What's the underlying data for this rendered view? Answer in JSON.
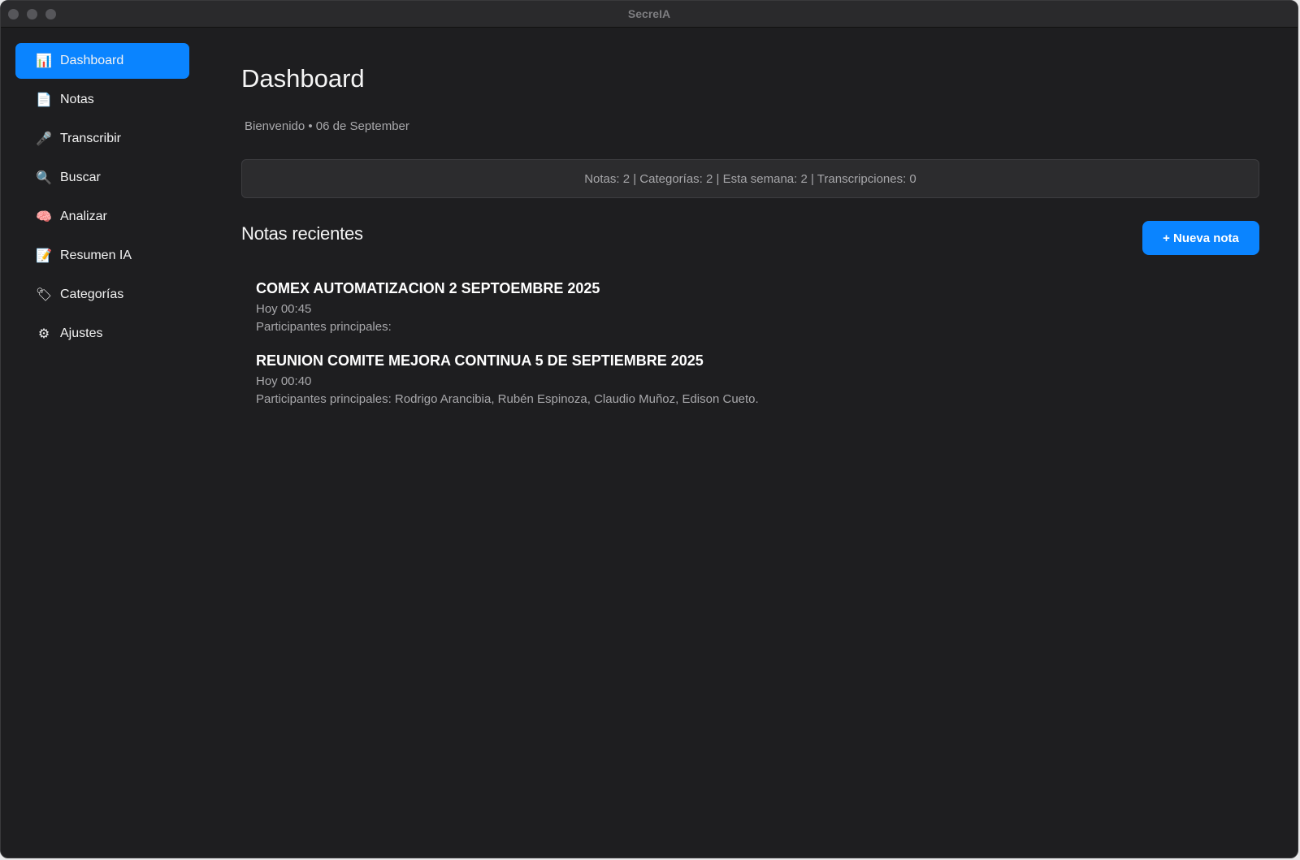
{
  "window": {
    "title": "SecreIA"
  },
  "sidebar": {
    "items": [
      {
        "icon": "📊",
        "icon_name": "bar-chart-icon",
        "label": "Dashboard",
        "active": true
      },
      {
        "icon": "📄",
        "icon_name": "document-icon",
        "label": "Notas"
      },
      {
        "icon": "🎤",
        "icon_name": "microphone-icon",
        "label": "Transcribir"
      },
      {
        "icon": "🔍",
        "icon_name": "magnifier-icon",
        "label": "Buscar"
      },
      {
        "icon": "🧠",
        "icon_name": "brain-icon",
        "label": "Analizar"
      },
      {
        "icon": "📝",
        "icon_name": "memo-icon",
        "label": "Resumen IA"
      },
      {
        "icon": "🏷",
        "icon_name": "tag-icon",
        "label": "Categorías"
      },
      {
        "icon": "⚙",
        "icon_name": "gear-icon",
        "label": "Ajustes"
      }
    ]
  },
  "main": {
    "title": "Dashboard",
    "subtitle": "Bienvenido • 06 de September",
    "stats": "Notas: 2 | Categorías: 2 | Esta semana: 2 | Transcripciones: 0",
    "recent_title": "Notas recientes",
    "new_note_label": "+ Nueva nota",
    "notes": [
      {
        "title": "COMEX AUTOMATIZACION 2 SEPTOEMBRE 2025",
        "date": "Hoy 00:45",
        "preview": "Participantes principales:"
      },
      {
        "title": "REUNION COMITE MEJORA CONTINUA 5 DE SEPTIEMBRE 2025",
        "date": "Hoy 00:40",
        "preview": "Participantes principales: Rodrigo Arancibia, Rubén Espinoza, Claudio Muñoz, Edison Cueto."
      }
    ]
  },
  "colors": {
    "accent": "#0a84ff",
    "background": "#1e1e20",
    "panel": "#2c2c2e"
  }
}
